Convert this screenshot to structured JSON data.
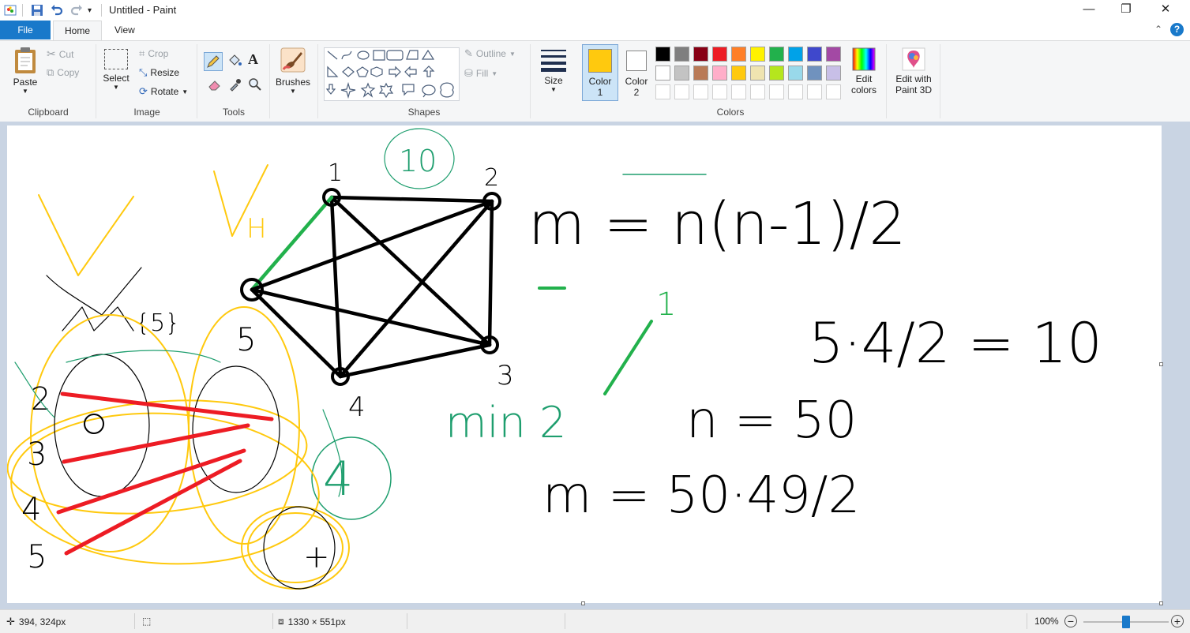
{
  "window": {
    "title": "Untitled - Paint",
    "minimize_glyph": "—",
    "maximize_glyph": "❐",
    "close_glyph": "✕"
  },
  "tabs": {
    "file": "File",
    "home": "Home",
    "view": "View"
  },
  "clipboard": {
    "paste": "Paste",
    "cut": "Cut",
    "copy": "Copy",
    "group": "Clipboard"
  },
  "image": {
    "select": "Select",
    "crop": "Crop",
    "resize": "Resize",
    "rotate": "Rotate",
    "group": "Image"
  },
  "tools": {
    "group": "Tools",
    "text_glyph": "A"
  },
  "brushes": {
    "label": "Brushes"
  },
  "shapes": {
    "outline": "Outline",
    "fill": "Fill",
    "group": "Shapes"
  },
  "size": {
    "label": "Size"
  },
  "color1": {
    "label_line1": "Color",
    "label_line2": "1",
    "value": "#ffc90e"
  },
  "color2": {
    "label_line1": "Color",
    "label_line2": "2",
    "value": "#ffffff"
  },
  "colors": {
    "group": "Colors",
    "row1": [
      "#000000",
      "#7f7f7f",
      "#880015",
      "#ed1c24",
      "#ff7f27",
      "#fff200",
      "#22b14c",
      "#00a2e8",
      "#3f48cc",
      "#a349a4"
    ],
    "row2": [
      "#ffffff",
      "#c3c3c3",
      "#b97a57",
      "#ffaec9",
      "#ffc90e",
      "#efe4b0",
      "#b5e61d",
      "#99d9ea",
      "#7092be",
      "#c8bfe7"
    ],
    "row3": [
      "#ffffff",
      "#ffffff",
      "#ffffff",
      "#ffffff",
      "#ffffff",
      "#ffffff",
      "#ffffff",
      "#ffffff",
      "#ffffff",
      "#ffffff"
    ],
    "edit_line1": "Edit",
    "edit_line2": "colors"
  },
  "paint3d": {
    "line1": "Edit with",
    "line2": "Paint 3D"
  },
  "status": {
    "cursor": "394, 324px",
    "canvas_size": "1330 × 551px",
    "zoom": "100%",
    "zoom_level": 1.0
  },
  "drawing": {
    "graph_labels": [
      "1",
      "2",
      "3",
      "4",
      "5"
    ],
    "formula_text": "m = n(n-1)/2",
    "calc_text": "5·4/2 = 10",
    "n_text": "n = 50",
    "m_text": "m = 50·49/2",
    "circled_10": "10",
    "circled_4": "4",
    "min_text": "min 2",
    "colors": {
      "black": "#000000",
      "green": "#22b14c",
      "red": "#ed1c24",
      "yellow": "#ffc90e",
      "teal": "#1e9e6e"
    }
  }
}
